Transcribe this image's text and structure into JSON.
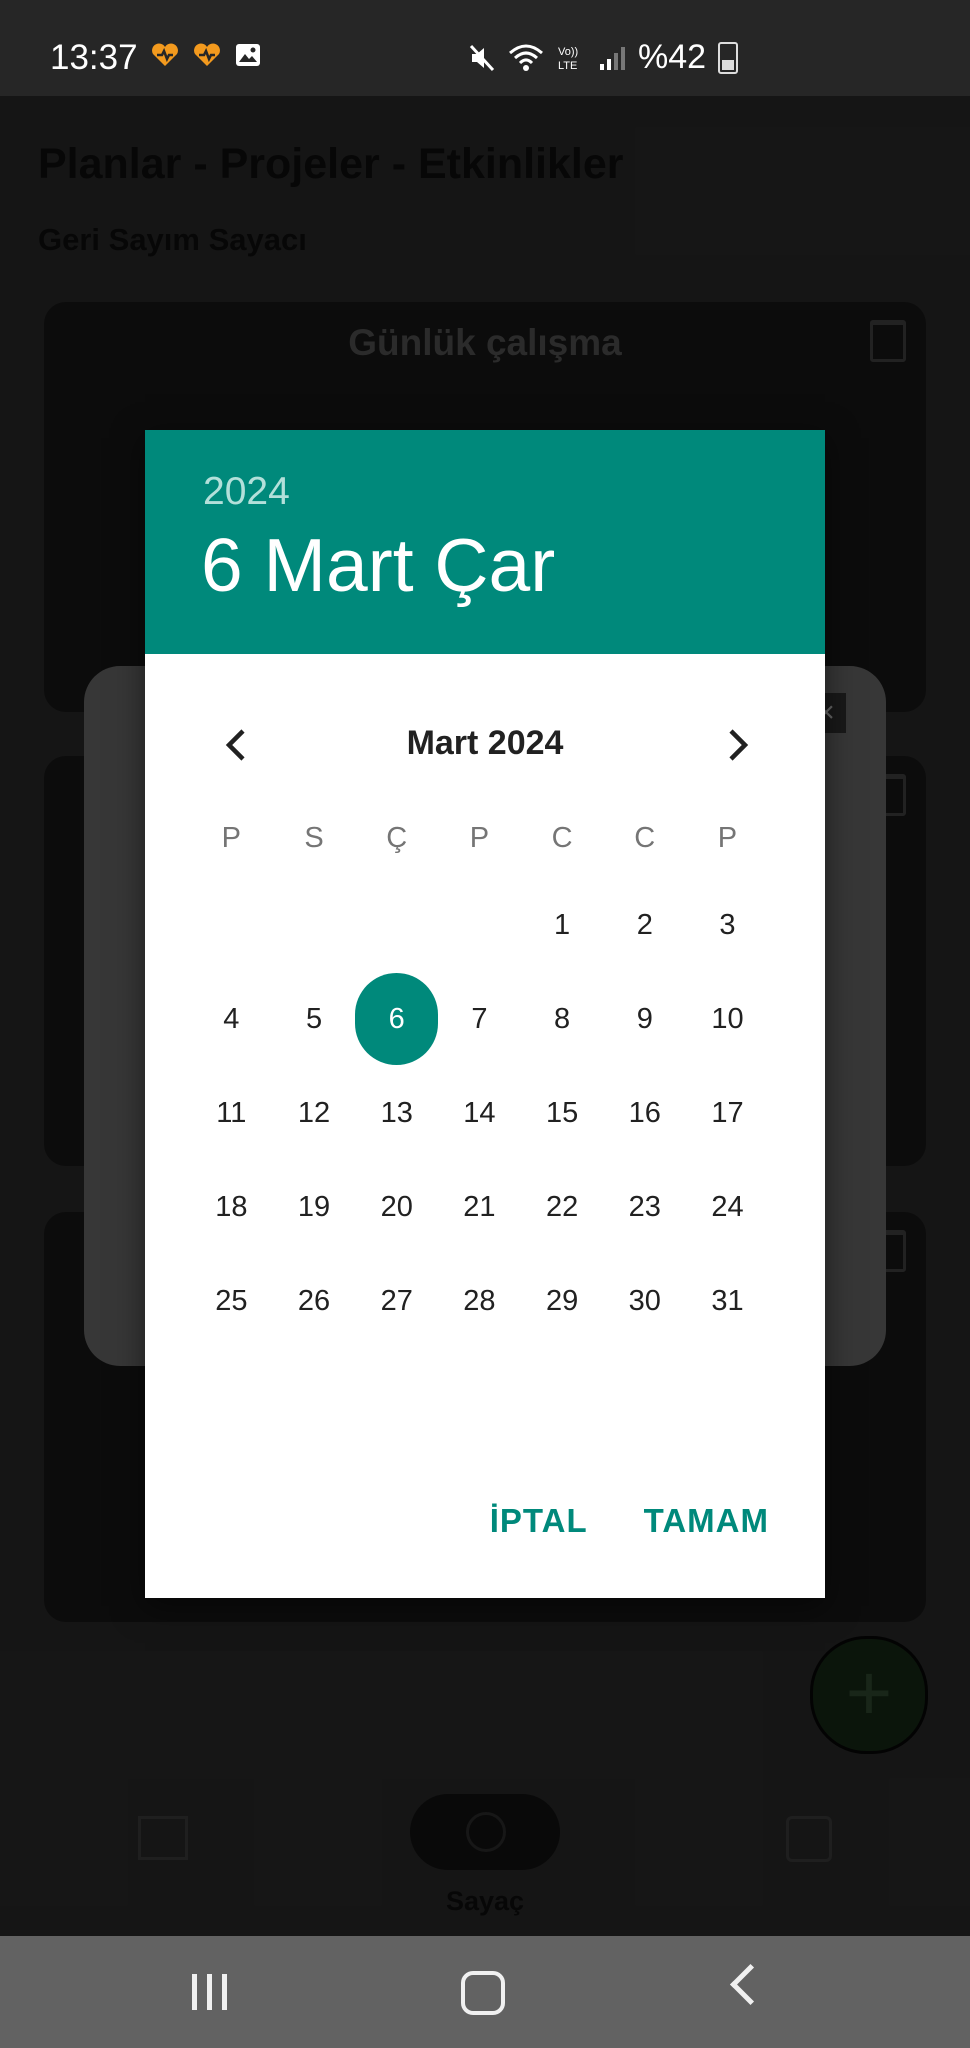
{
  "status_bar": {
    "time": "13:37",
    "battery_text": "%42"
  },
  "app": {
    "title": "Planlar - Projeler - Etkinlikler",
    "subtitle": "Geri Sayım Sayacı",
    "card_title": "Günlük çalışma",
    "nav_label": "Sayaç"
  },
  "date_picker": {
    "header_year": "2024",
    "header_date": "6 Mart Çar",
    "month_label": "Mart 2024",
    "weekdays": [
      "P",
      "S",
      "Ç",
      "P",
      "C",
      "C",
      "P"
    ],
    "leading_blanks": 4,
    "days": [
      "1",
      "2",
      "3",
      "4",
      "5",
      "6",
      "7",
      "8",
      "9",
      "10",
      "11",
      "12",
      "13",
      "14",
      "15",
      "16",
      "17",
      "18",
      "19",
      "20",
      "21",
      "22",
      "23",
      "24",
      "25",
      "26",
      "27",
      "28",
      "29",
      "30",
      "31"
    ],
    "selected_day": "6",
    "cancel_label": "İPTAL",
    "ok_label": "TAMAM",
    "accent_color": "#00897b"
  }
}
